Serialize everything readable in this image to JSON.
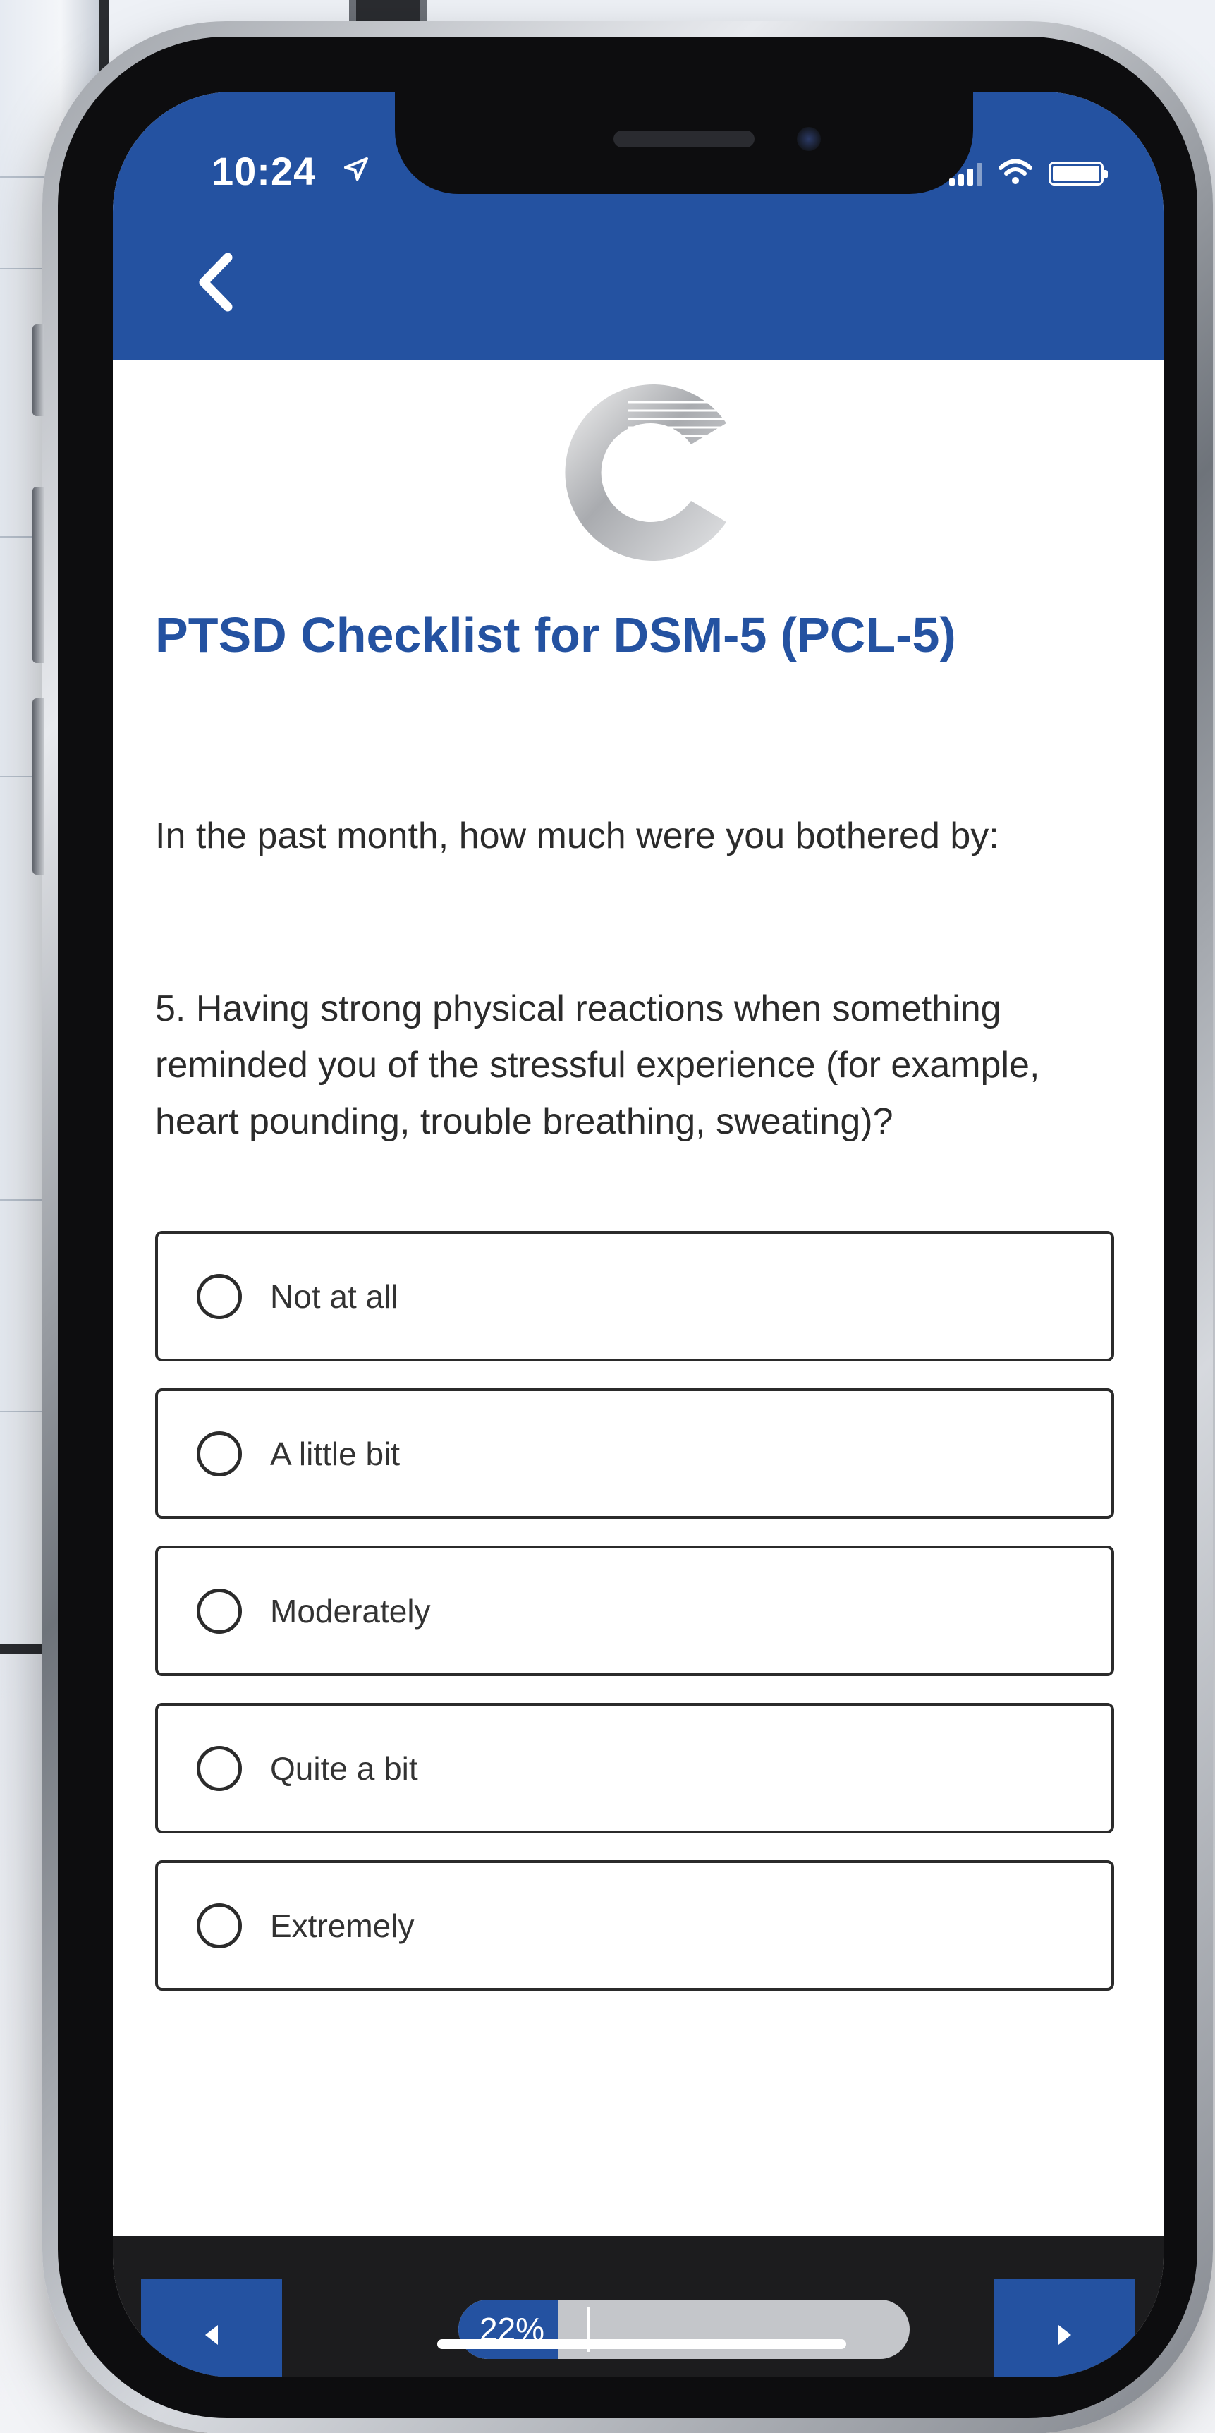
{
  "status_bar": {
    "time": "10:24",
    "icons": [
      "location-arrow-icon",
      "signal-icon",
      "wifi-icon",
      "battery-icon"
    ]
  },
  "header": {
    "back_icon": "chevron-left-icon",
    "logo_icon": "c-logo-icon",
    "title": "PTSD Checklist for DSM-5 (PCL-5)"
  },
  "survey": {
    "prompt": "In the past month, how much were you bothered by:",
    "question": "5. Having strong physical reactions when something reminded you of the stressful experience (for example, heart pounding, trouble breathing, sweating)?",
    "options": [
      {
        "label": "Not at all",
        "selected": false
      },
      {
        "label": "A little bit",
        "selected": false
      },
      {
        "label": "Moderately",
        "selected": false
      },
      {
        "label": "Quite a bit",
        "selected": false
      },
      {
        "label": "Extremely",
        "selected": false
      }
    ]
  },
  "footer": {
    "prev_icon": "caret-left-icon",
    "next_icon": "caret-right-icon",
    "progress_label": "22%",
    "progress_value": 22
  },
  "colors": {
    "brand_blue": "#2452a1",
    "text_dark": "#2b2b2b",
    "footer_bg": "#1c1c1e",
    "progress_track": "#c4c6ca"
  }
}
